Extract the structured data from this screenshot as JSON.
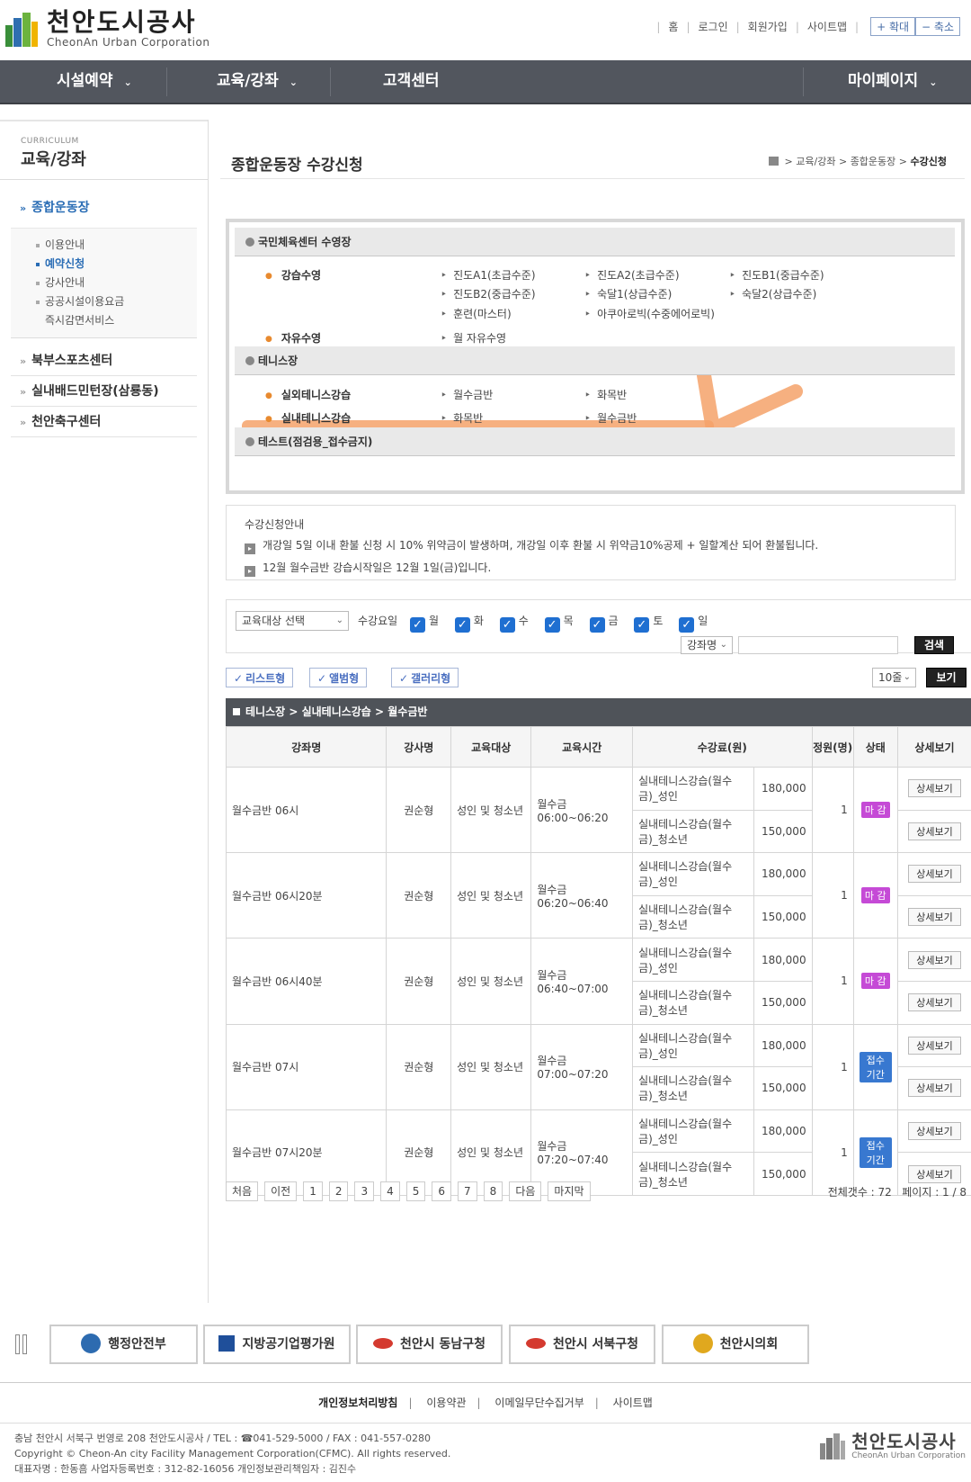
{
  "header": {
    "logo_title": "천안도시공사",
    "logo_sub": "CheonAn Urban Corporation",
    "utils": [
      "홈",
      "로그인",
      "회원가입",
      "사이트맵"
    ],
    "zoom_in": "+ 확대",
    "zoom_out": "− 축소"
  },
  "gnb": {
    "items": [
      "시설예약",
      "교육/강좌",
      "고객센터",
      "마이페이지"
    ]
  },
  "lnb": {
    "curriculum": "CURRICULUM",
    "title": "교육/강좌",
    "active_category": "종합운동장",
    "sub_items": [
      "이용안내",
      "예약신청",
      "강사안내",
      "공공시설이용요금",
      "즉시감면서비스"
    ],
    "categories": [
      "북부스포츠센터",
      "실내배드민턴장(삼룡동)",
      "천안축구센터"
    ]
  },
  "page": {
    "title": "종합운동장 수강신청",
    "breadcrumb": [
      "교육/강좌",
      "종합운동장",
      "수강신청"
    ]
  },
  "programs": {
    "pool_head": "국민체육센터 수영장",
    "lesson_swim": "강습수영",
    "lesson_links": [
      "진도A1(초급수준)",
      "진도A2(초급수준)",
      "진도B1(중급수준)",
      "진도B2(중급수준)",
      "숙달1(상급수준)",
      "숙달2(상급수준)",
      "훈련(마스터)",
      "아쿠아로빅(수중에어로빅)"
    ],
    "free_swim": "자유수영",
    "free_links": [
      "월 자유수영"
    ],
    "tennis_head": "테니스장",
    "outdoor_tennis": "실외테니스강습",
    "outdoor_links": [
      "월수금반",
      "화목반"
    ],
    "indoor_tennis": "실내테니스강습",
    "indoor_links": [
      "화목반",
      "월수금반"
    ],
    "test_head": "테스트(점검용_접수금지)"
  },
  "notice": {
    "title": "수강신청안내",
    "items": [
      "개강일 5일 이내 환불 신청 시 10% 위약금이 발생하며, 개강일 이후 환불 시 위약금10%공제 + 일할계산 되어 환불됩니다.",
      "12월 월수금반 강습시작일은 12월 1일(금)입니다."
    ]
  },
  "filter": {
    "target_select": "교육대상 선택",
    "day_label": "수강요일",
    "days": [
      "월",
      "화",
      "수",
      "목",
      "금",
      "토",
      "일"
    ],
    "search_select": "강좌명",
    "search_placeholder": "",
    "search_button": "검색",
    "per_page": "10줄",
    "view_button": "보기"
  },
  "view_modes": [
    "리스트형",
    "앨범형",
    "갤러리형"
  ],
  "table": {
    "caption": "테니스장 > 실내테니스강습 > 월수금반",
    "headers": [
      "강좌명",
      "강사명",
      "교육대상",
      "교육시간",
      "수강료(원)",
      "정원(명)",
      "상태",
      "상세보기"
    ],
    "rows": [
      {
        "name": "월수금반 06시",
        "teacher": "권순형",
        "target": "성인 및 청소년",
        "days": "월수금",
        "time": "06:00~06:20",
        "fee_adult_label": "실내테니스강습(월수금)_성인",
        "fee_adult": "180,000",
        "fee_youth_label": "실내테니스강습(월수금)_청소년",
        "fee_youth": "150,000",
        "capacity": "1",
        "status": "마 감",
        "detail": "상세보기"
      },
      {
        "name": "월수금반 06시20분",
        "teacher": "권순형",
        "target": "성인 및 청소년",
        "days": "월수금",
        "time": "06:20~06:40",
        "fee_adult_label": "실내테니스강습(월수금)_성인",
        "fee_adult": "180,000",
        "fee_youth_label": "실내테니스강습(월수금)_청소년",
        "fee_youth": "150,000",
        "capacity": "1",
        "status": "마 감",
        "detail": "상세보기"
      },
      {
        "name": "월수금반 06시40분",
        "teacher": "권순형",
        "target": "성인 및 청소년",
        "days": "월수금",
        "time": "06:40~07:00",
        "fee_adult_label": "실내테니스강습(월수금)_성인",
        "fee_adult": "180,000",
        "fee_youth_label": "실내테니스강습(월수금)_청소년",
        "fee_youth": "150,000",
        "capacity": "1",
        "status": "마 감",
        "detail": "상세보기"
      },
      {
        "name": "월수금반 07시",
        "teacher": "권순형",
        "target": "성인 및 청소년",
        "days": "월수금",
        "time": "07:00~07:20",
        "fee_adult_label": "실내테니스강습(월수금)_성인",
        "fee_adult": "180,000",
        "fee_youth_label": "실내테니스강습(월수금)_청소년",
        "fee_youth": "150,000",
        "capacity": "1",
        "status": "접수기간",
        "detail": "상세보기"
      },
      {
        "name": "월수금반 07시20분",
        "teacher": "권순형",
        "target": "성인 및 청소년",
        "days": "월수금",
        "time": "07:20~07:40",
        "fee_adult_label": "실내테니스강습(월수금)_성인",
        "fee_adult": "180,000",
        "fee_youth_label": "실내테니스강습(월수금)_청소년",
        "fee_youth": "150,000",
        "capacity": "1",
        "status": "접수기간",
        "detail": "상세보기"
      }
    ]
  },
  "pager": {
    "first": "처음",
    "prev": "이전",
    "pages": [
      "1",
      "2",
      "3",
      "4",
      "5",
      "6",
      "7",
      "8"
    ],
    "next": "다음",
    "last": "마지막",
    "total": "전체갯수 : 72",
    "page_info": "페이지 : 1 / 8"
  },
  "footer": {
    "banners": [
      "행정안전부",
      "지방공기업평가원",
      "천안시 동남구청",
      "천안시 서북구청",
      "천안시의회"
    ],
    "links": [
      "개인정보처리방침",
      "이용약관",
      "이메일무단수집거부",
      "사이트맵"
    ],
    "info1": "충남 천안시 서북구 번영로 208 천안도시공사 / TEL : ☎041-529-5000 / FAX : 041-557-0280",
    "info2": "Copyright © Cheon-An city Facility Management Corporation(CFMC). All rights reserved.",
    "info3": "대표자명 : 한동흠    사업자등록번호 : 312-82-16056    개인정보관리책임자 : 김진수",
    "logo_title": "천안도시공사",
    "logo_sub": "CheonAn Urban Corporation"
  },
  "colors": {
    "gnb": "#52565e",
    "accent_blue": "#2a6db5",
    "closed_badge": "#c54ad6",
    "open_badge": "#3878d0",
    "highlight": "#f5a26a",
    "checkbox": "#1f6fd1"
  }
}
